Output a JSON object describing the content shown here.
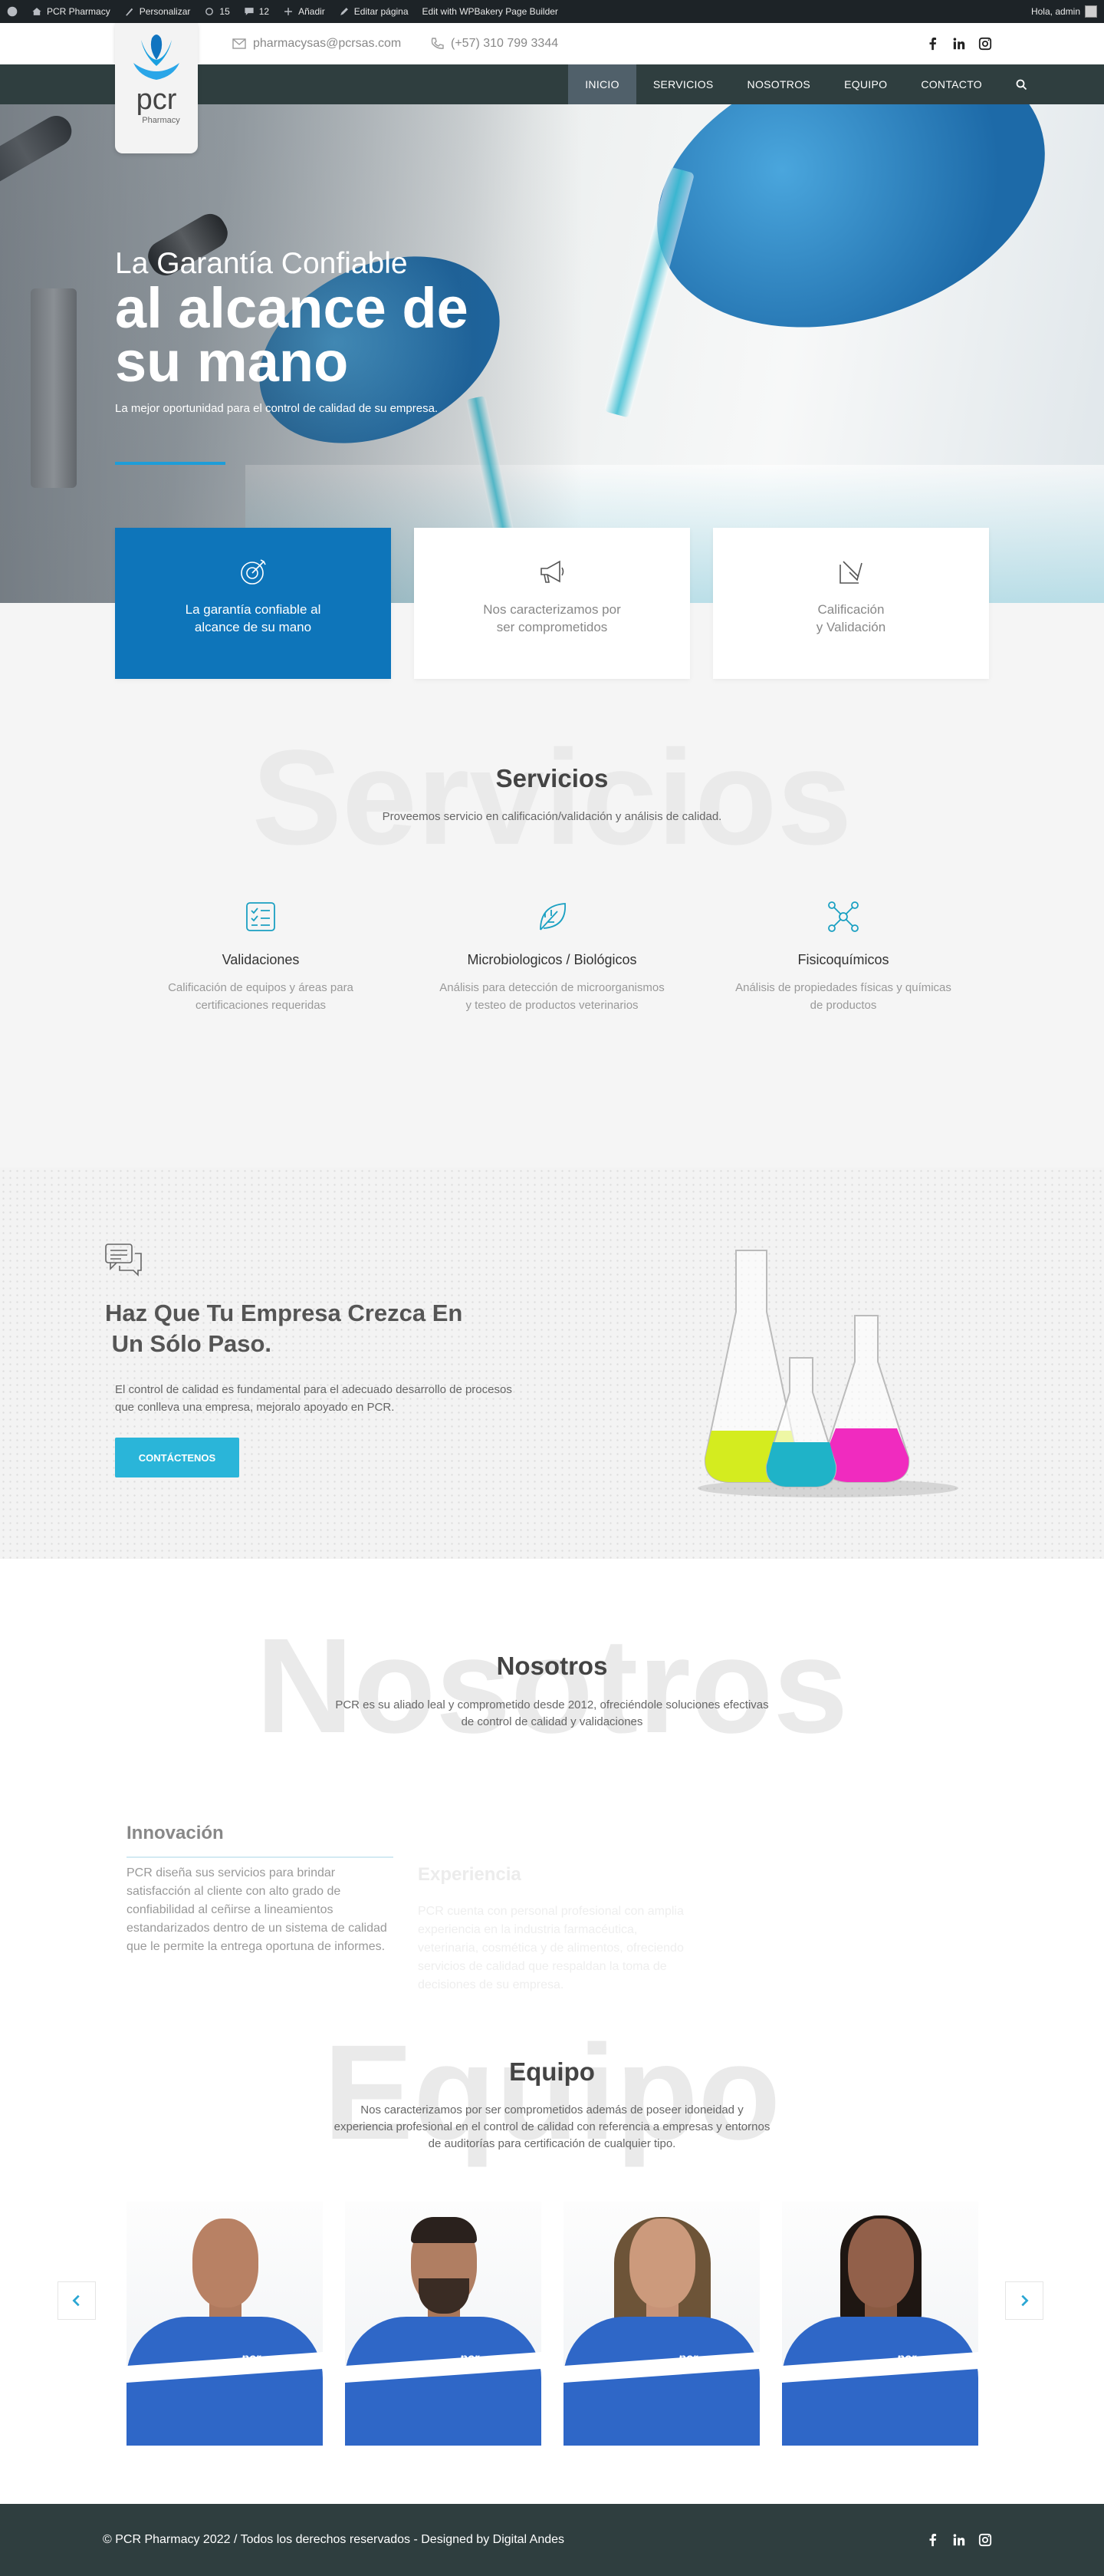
{
  "adminbar": {
    "site": "PCR Pharmacy",
    "customize": "Personalizar",
    "updates": "15",
    "comments": "12",
    "add_new": "Añadir",
    "edit_page": "Editar página",
    "wpbakery": "Edit with WPBakery Page Builder",
    "greeting": "Hola, admin"
  },
  "contact": {
    "email": "pharmacysas@pcrsas.com",
    "phone": "(+57) 310 799 3344"
  },
  "logo": {
    "brand": "pcr",
    "sub": "Pharmacy"
  },
  "nav": {
    "items": [
      "INICIO",
      "SERVICIOS",
      "NOSOTROS",
      "EQUIPO",
      "CONTACTO"
    ],
    "active": "INICIO"
  },
  "hero": {
    "subtitle": "La Garantía Confiable",
    "title_line1": "al alcance de",
    "title_line2": "su mano",
    "description": "La mejor oportunidad para el control de calidad de su empresa."
  },
  "features": [
    {
      "line1": "La garantía confiable al",
      "line2": "alcance de su mano",
      "icon": "target-icon"
    },
    {
      "line1": "Nos caracterizamos por",
      "line2": "ser comprometidos",
      "icon": "megaphone-icon"
    },
    {
      "line1": "Calificación",
      "line2": "y Validación",
      "icon": "check-box-icon"
    }
  ],
  "services": {
    "bg_word": "Servicios",
    "title": "Servicios",
    "subtitle": "Proveemos servicio en calificación/validación y análisis de calidad.",
    "items": [
      {
        "title": "Validaciones",
        "desc": "Calificación de equipos y áreas para certificaciones requeridas",
        "icon": "checklist-icon"
      },
      {
        "title": "Microbiologicos / Biológicos",
        "desc": "Análisis para detección de microorganismos y testeo de productos veterinarios",
        "icon": "leaf-icon"
      },
      {
        "title": "Fisicoquímicos",
        "desc": "Análisis de propiedades físicas y químicas de productos",
        "icon": "molecule-icon"
      }
    ]
  },
  "grow": {
    "title_line1": "Haz Que Tu Empresa Crezca En",
    "title_line2": " Un Sólo Paso.",
    "description": "El control de calidad es fundamental para el adecuado desarrollo de procesos que conlleva una empresa, mejoralo apoyado en PCR.",
    "button": "CONTÁCTENOS"
  },
  "about": {
    "bg_word": "Nosotros",
    "title": "Nosotros",
    "subtitle": "PCR es su aliado leal y comprometido desde 2012, ofreciéndole soluciones efectivas de control de calidad y validaciones",
    "innovation_title": "Innovación",
    "innovation_desc": "PCR diseña sus servicios para brindar satisfacción al cliente con alto grado de confiabilidad al ceñirse a lineamientos estandarizados dentro de un sistema de calidad que le permite la entrega oportuna de informes.",
    "experience_title": "Experiencia",
    "experience_desc": "PCR cuenta con personal profesional con amplia experiencia en la industria farmacéutica, veterinaria, cosmética y de alimentos, ofreciendo servicios de calidad que respaldan la toma de decisiones de su empresa."
  },
  "team": {
    "bg_word": "Equipo",
    "title": "Equipo",
    "subtitle": "Nos caracterizamos por ser comprometidos además de poseer idoneidad y experiencia profesional en el control de calidad con referencia a empresas y entornos de auditorías para certificación de cualquier tipo.",
    "jacket_logo": "pcr"
  },
  "footer": {
    "copyright": "© PCR Pharmacy 2022 / Todos los derechos reservados - Designed by Digital Andes"
  }
}
